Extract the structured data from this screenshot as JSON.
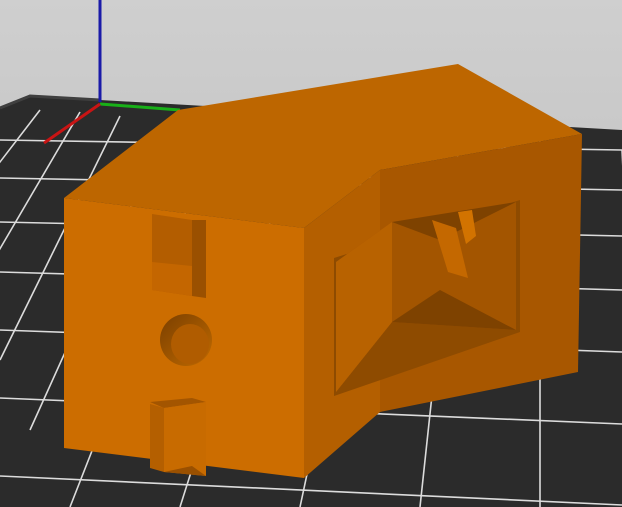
{
  "viewport": {
    "label": "3D view",
    "colors": {
      "background_top": "#cbcbcb",
      "background_bottom": "#b9b9b9",
      "bed": "#2e2e2e",
      "bed_border": "#3a3a3a",
      "grid_line": "#e4e4e4",
      "model_top": "#c06a00",
      "model_front": "#d06f00",
      "model_side": "#a85a00",
      "model_dark": "#8a4a00",
      "axis_x": "#c81414",
      "axis_y": "#18b018",
      "axis_z": "#1a1aa8"
    }
  },
  "axes": [
    {
      "name": "x-axis",
      "color": "#c81414"
    },
    {
      "name": "y-axis",
      "color": "#18b018"
    },
    {
      "name": "z-axis",
      "color": "#1a1aa8"
    }
  ],
  "model": {
    "name": "printed-part",
    "features": [
      "top-face",
      "front-face",
      "right-side-face",
      "window-opening",
      "screw-hole",
      "slot-notch-upper",
      "slot-notch-lower"
    ]
  }
}
